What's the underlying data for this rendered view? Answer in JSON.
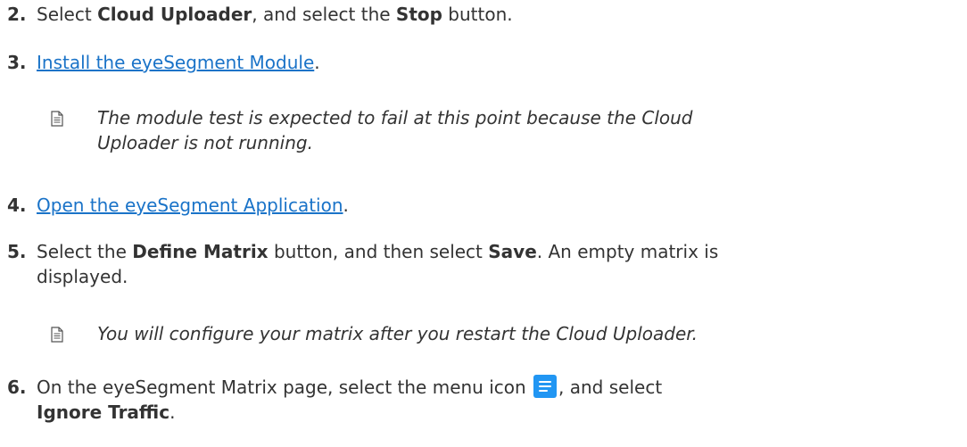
{
  "steps": {
    "s2": {
      "num": "2.",
      "t1": "Select ",
      "b1": "Cloud Uploader",
      "t2": ", and select the ",
      "b2": "Stop",
      "t3": " button."
    },
    "s3": {
      "num": "3.",
      "link": "Install the eyeSegment Module",
      "t1": "."
    },
    "note1": {
      "line1": "The module test is expected to fail at this point because the Cloud",
      "line2": "Uploader is not running."
    },
    "s4": {
      "num": "4.",
      "link": "Open the eyeSegment Application",
      "t1": "."
    },
    "s5": {
      "num": "5.",
      "t1": "Select the ",
      "b1": "Define Matrix",
      "t2": " button, and then select ",
      "b2": "Save",
      "t3": ". An empty matrix is",
      "line2": "displayed."
    },
    "note2": {
      "line1": "You will configure your matrix after you restart the Cloud Uploader."
    },
    "s6": {
      "num": "6.",
      "t1": "On the eyeSegment Matrix page, select the menu icon ",
      "t2": ", and select",
      "b1": "Ignore Traffic",
      "t3": "."
    }
  },
  "icons": {
    "note": "note-page-icon",
    "menu": "hamburger-menu-icon",
    "menu_color": "#2196f3"
  },
  "colors": {
    "link": "#1a73c8",
    "text": "#333333"
  }
}
